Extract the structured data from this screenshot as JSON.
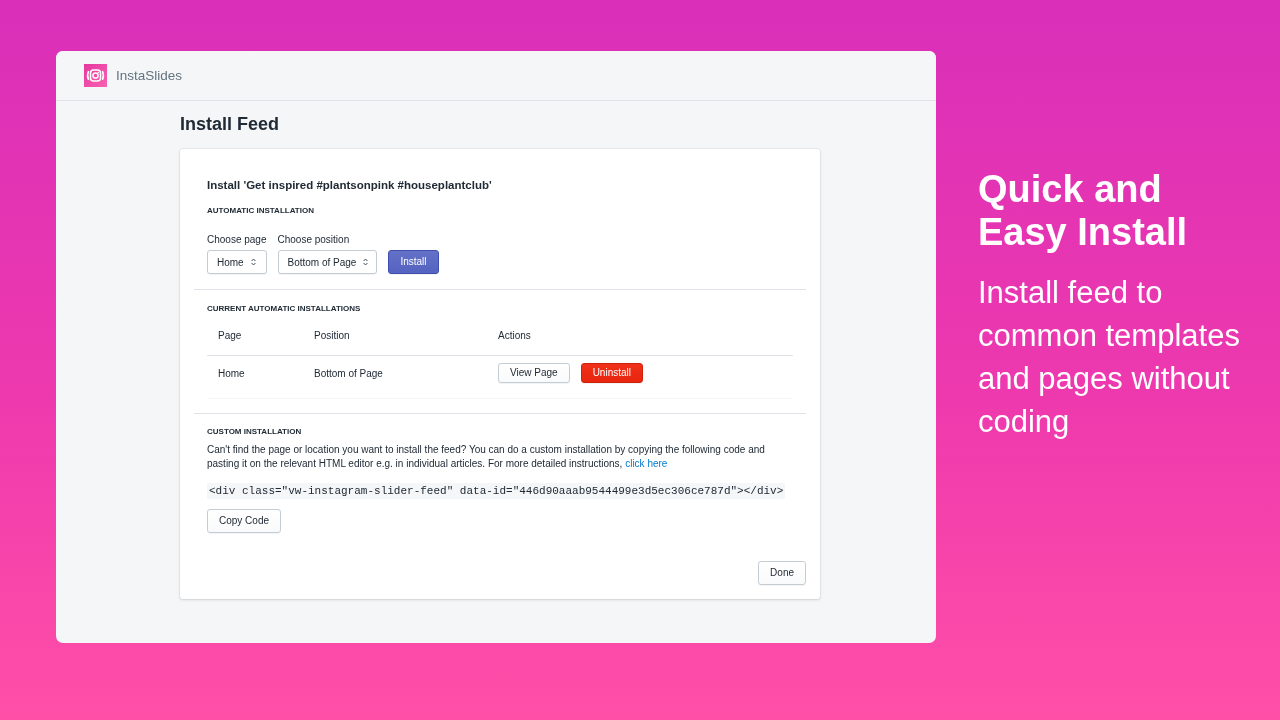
{
  "header": {
    "app_name": "InstaSlides"
  },
  "page_title": "Install Feed",
  "card": {
    "title": "Install 'Get inspired #plantsonpink #houseplantclub'",
    "automatic_installation": {
      "heading": "AUTOMATIC INSTALLATION",
      "fields": [
        {
          "label": "Choose page",
          "value": "Home"
        },
        {
          "label": "Choose position",
          "value": "Bottom of Page"
        }
      ],
      "button": {
        "label": "Install",
        "kind": "primary"
      }
    },
    "current_installations": {
      "heading": "CURRENT AUTOMATIC INSTALLATIONS",
      "columns": [
        "Page",
        "Position",
        "Actions"
      ],
      "rows": [
        {
          "page": "Home",
          "position": "Bottom of Page",
          "actions": [
            {
              "label": "View Page",
              "kind": "secondary"
            },
            {
              "label": "Uninstall",
              "kind": "destructive"
            }
          ]
        }
      ]
    },
    "custom_installation": {
      "heading": "CUSTOM INSTALLATION",
      "text": "Can't find the page or location you want to install the feed? You can do a custom installation by copying the following code and pasting it on the relevant HTML editor e.g. in individual articles. For more detailed instructions,",
      "link": "click here",
      "code": "<div class=\"vw-instagram-slider-feed\" data-id=\"446d90aaab9544499e3d5ec306ce787d\"></div>",
      "button": {
        "label": "Copy Code",
        "kind": "secondary"
      }
    },
    "footer_button": {
      "label": "Done",
      "kind": "secondary"
    }
  },
  "promo": {
    "title": "Quick and Easy Install",
    "text": "Install feed to common templates and pages without coding"
  }
}
